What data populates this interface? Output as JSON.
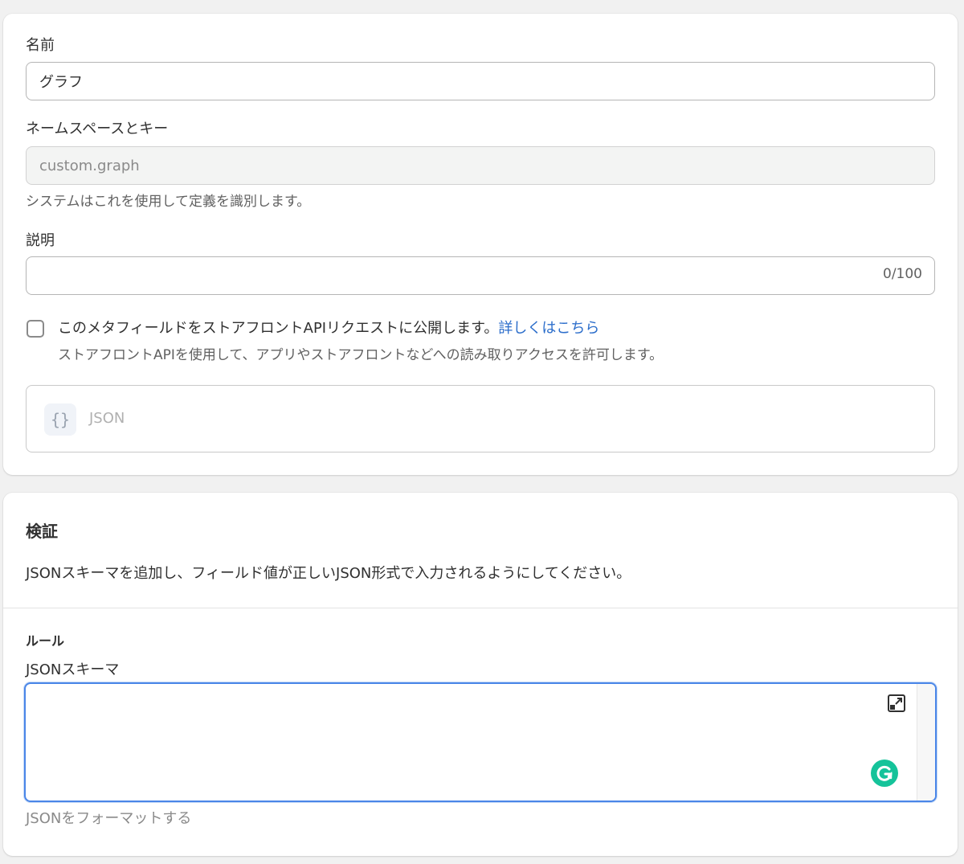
{
  "definition": {
    "name_label": "名前",
    "name_value": "グラフ",
    "namespace_label": "ネームスペースとキー",
    "namespace_value": "custom.graph",
    "namespace_help": "システムはこれを使用して定義を識別します。",
    "description_label": "説明",
    "description_value": "",
    "description_counter": "0/100",
    "storefront_checkbox_checked": false,
    "storefront_checkbox_text": "このメタフィールドをストアフロントAPIリクエストに公開します。",
    "storefront_learn_more": "詳しくはこちら",
    "storefront_help": "ストアフロントAPIを使用して、アプリやストアフロントなどへの読み取りアクセスを許可します。",
    "type_icon": "{}",
    "type_label": "JSON"
  },
  "validation": {
    "title": "検証",
    "description": "JSONスキーマを追加し、フィールド値が正しいJSON形式で入力されるようにしてください。",
    "rules_title": "ルール",
    "schema_label": "JSONスキーマ",
    "schema_value": "",
    "format_link": "JSONをフォーマットする"
  },
  "colors": {
    "link": "#2c6ecb",
    "focus": "#4a86e8",
    "grammarly": "#15c39a"
  },
  "icons": {
    "expand": "expand-icon",
    "grammarly": "grammarly-icon",
    "json_type": "json-braces-icon"
  }
}
